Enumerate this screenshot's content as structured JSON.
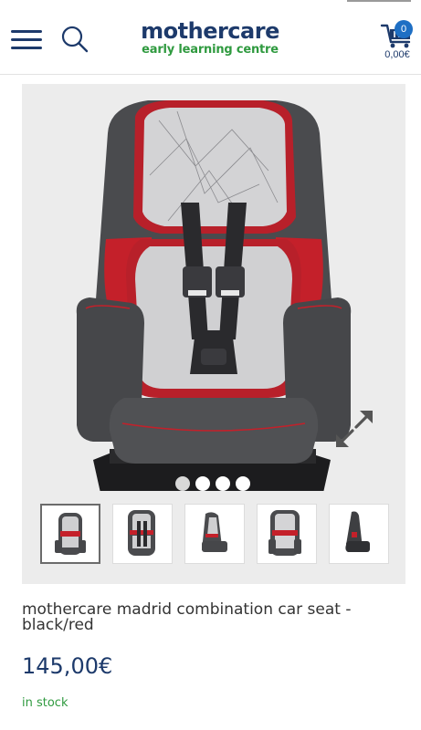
{
  "header": {
    "logo_main": "mothercare",
    "logo_sub": "early learning centre",
    "cart_count": "0",
    "cart_total": "0,00€"
  },
  "gallery": {
    "image_count": 4,
    "active_dot": 0,
    "thumbnail_count": 5,
    "selected_thumbnail": 0
  },
  "product": {
    "title": "mothercare madrid combination car seat - black/red",
    "price": "145,00€",
    "stock_status": "in stock"
  },
  "colors": {
    "brand_navy": "#1d3a6b",
    "brand_green": "#2f9a3f",
    "badge_blue": "#1e6fc4",
    "seat_red": "#c4202a",
    "seat_gray": "#4a4b4e"
  },
  "icons": [
    "menu-icon",
    "search-icon",
    "cart-icon",
    "expand-icon"
  ]
}
